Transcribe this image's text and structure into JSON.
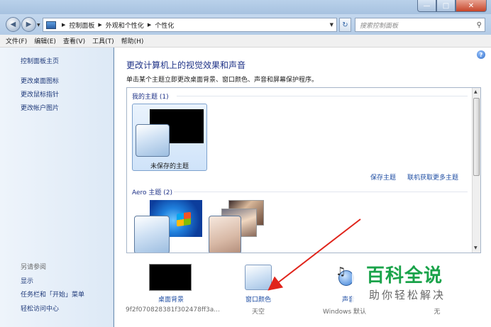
{
  "window": {
    "minimize_glyph": "—",
    "maximize_glyph": "□",
    "close_glyph": "✕"
  },
  "nav": {
    "back_glyph": "◀",
    "forward_glyph": "▶",
    "refresh_glyph": "↻"
  },
  "address": {
    "icon": "control-panel-icon",
    "crumbs": [
      "控制面板",
      "外观和个性化",
      "个性化"
    ]
  },
  "search": {
    "placeholder": "搜索控制面板"
  },
  "menu": [
    "文件(F)",
    "编辑(E)",
    "查看(V)",
    "工具(T)",
    "帮助(H)"
  ],
  "sidebar": {
    "items": [
      "控制面板主页",
      "更改桌面图标",
      "更改鼠标指针",
      "更改帐户图片"
    ],
    "see_also_title": "另请参阅",
    "see_also": [
      "显示",
      "任务栏和「开始」菜单",
      "轻松访问中心"
    ]
  },
  "main": {
    "title": "更改计算机上的视觉效果和声音",
    "description": "单击某个主题立即更改桌面背景、窗口颜色、声音和屏幕保护程序。",
    "my_themes_header": "我的主题 (1)",
    "unsaved_theme": "未保存的主题",
    "save_theme": "保存主题",
    "get_more_themes": "联机获取更多主题",
    "aero_header": "Aero 主题 (2)"
  },
  "bottom": {
    "background": {
      "label": "桌面背景",
      "value": "9f2f070828381f302478ff3a..."
    },
    "color": {
      "label": "窗口颜色",
      "value": "天空"
    },
    "sound": {
      "label": "声音",
      "value": "Windows 默认"
    },
    "screensaver": {
      "value": "无"
    }
  },
  "watermark": {
    "title": "百科全说",
    "subtitle": "助你轻松解决"
  },
  "colors": {
    "arrow": "#e0241b",
    "link": "#1f4ea3",
    "title": "#1e3287",
    "brand": "#1aa34a"
  }
}
